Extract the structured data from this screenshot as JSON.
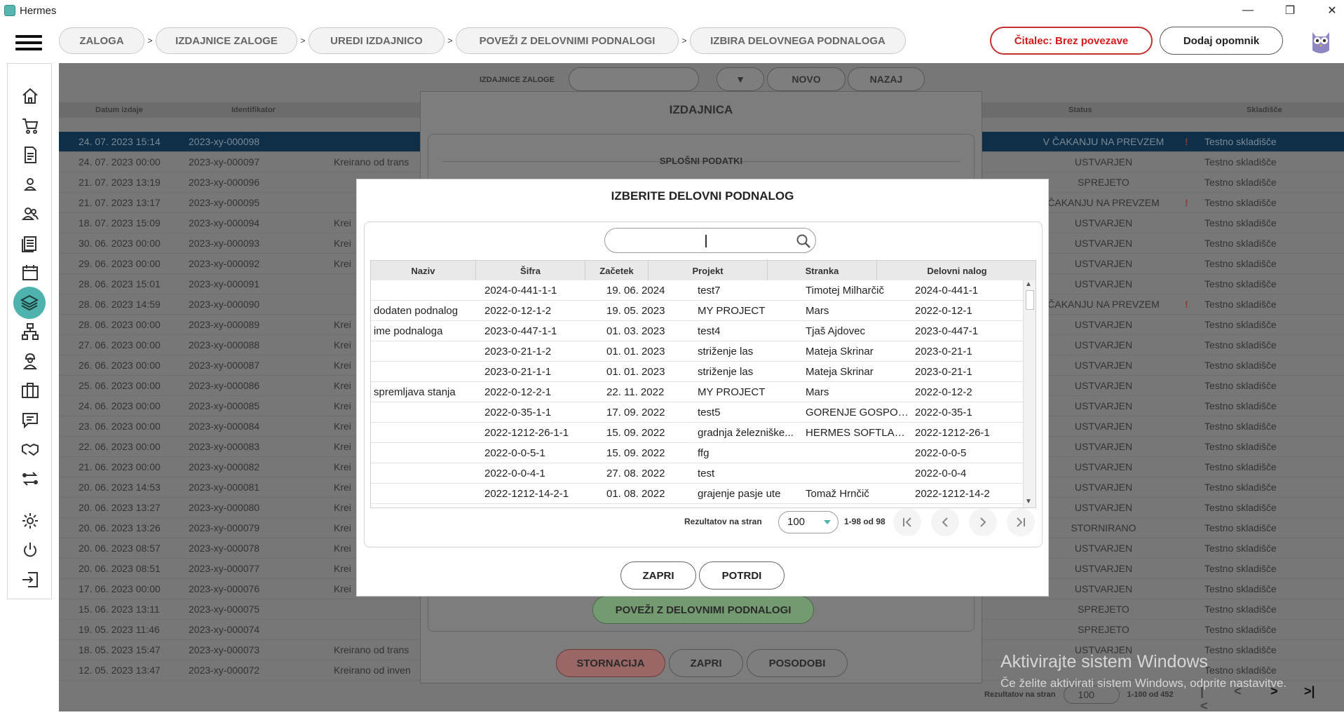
{
  "window": {
    "title": "Hermes"
  },
  "breadcrumbs": [
    "ZALOGA",
    "IZDAJNICE ZALOGE",
    "UREDI IZDAJNICO",
    "POVEŽI Z DELOVNIMI PODNALOGI",
    "IZBIRA DELOVNEGA PODNALOGA"
  ],
  "header": {
    "reader_status": "Čitalec: Brez povezave",
    "reminder_label": "Dodaj opomnik"
  },
  "background": {
    "toolbar_label": "IZDAJNICE ZALOGE",
    "new_label": "NOVO",
    "back_label": "NAZAJ",
    "columns": [
      "Datum izdaje",
      "Identifikator",
      "Status",
      "Skladišče"
    ],
    "rows": [
      [
        "24. 07. 2023 15:14",
        "2023-xy-000098",
        "",
        "V ČAKANJU NA PREVZEM",
        "Testno skladišče"
      ],
      [
        "24. 07. 2023 00:00",
        "2023-xy-000097",
        "Kreirano od trans",
        "USTVARJEN",
        "Testno skladišče"
      ],
      [
        "21. 07. 2023 13:19",
        "2023-xy-000096",
        "",
        "SPREJETO",
        "Testno skladišče"
      ],
      [
        "21. 07. 2023 13:17",
        "2023-xy-000095",
        "",
        "ČAKANJU NA PREVZEM",
        "Testno skladišče"
      ],
      [
        "18. 07. 2023 15:09",
        "2023-xy-000094",
        "Krei",
        "USTVARJEN",
        "Testno skladišče"
      ],
      [
        "30. 06. 2023 00:00",
        "2023-xy-000093",
        "Krei",
        "USTVARJEN",
        "Testno skladišče"
      ],
      [
        "29. 06. 2023 00:00",
        "2023-xy-000092",
        "Krei",
        "USTVARJEN",
        "Testno skladišče"
      ],
      [
        "28. 06. 2023 15:01",
        "2023-xy-000091",
        "",
        "USTVARJEN",
        "Testno skladišče"
      ],
      [
        "28. 06. 2023 14:59",
        "2023-xy-000090",
        "",
        "ČAKANJU NA PREVZEM",
        "Testno skladišče"
      ],
      [
        "28. 06. 2023 00:00",
        "2023-xy-000089",
        "Krei",
        "USTVARJEN",
        "Testno skladišče"
      ],
      [
        "27. 06. 2023 00:00",
        "2023-xy-000088",
        "Krei",
        "USTVARJEN",
        "Testno skladišče"
      ],
      [
        "26. 06. 2023 00:00",
        "2023-xy-000087",
        "Krei",
        "USTVARJEN",
        "Testno skladišče"
      ],
      [
        "25. 06. 2023 00:00",
        "2023-xy-000086",
        "Krei",
        "USTVARJEN",
        "Testno skladišče"
      ],
      [
        "24. 06. 2023 00:00",
        "2023-xy-000085",
        "Krei",
        "USTVARJEN",
        "Testno skladišče"
      ],
      [
        "23. 06. 2023 00:00",
        "2023-xy-000084",
        "Krei",
        "USTVARJEN",
        "Testno skladišče"
      ],
      [
        "22. 06. 2023 00:00",
        "2023-xy-000083",
        "Krei",
        "USTVARJEN",
        "Testno skladišče"
      ],
      [
        "21. 06. 2023 00:00",
        "2023-xy-000082",
        "Krei",
        "USTVARJEN",
        "Testno skladišče"
      ],
      [
        "20. 06. 2023 14:53",
        "2023-xy-000081",
        "Krei",
        "USTVARJEN",
        "Testno skladišče"
      ],
      [
        "20. 06. 2023 13:27",
        "2023-xy-000080",
        "Krei",
        "USTVARJEN",
        "Testno skladišče"
      ],
      [
        "20. 06. 2023 13:26",
        "2023-xy-000079",
        "Krei",
        "STORNIRANO",
        "Testno skladišče"
      ],
      [
        "20. 06. 2023 08:57",
        "2023-xy-000078",
        "Krei",
        "USTVARJEN",
        "Testno skladišče"
      ],
      [
        "20. 06. 2023 08:51",
        "2023-xy-000077",
        "Krei",
        "USTVARJEN",
        "Testno skladišče"
      ],
      [
        "17. 06. 2023 00:00",
        "2023-xy-000076",
        "Krei",
        "USTVARJEN",
        "Testno skladišče"
      ],
      [
        "15. 06. 2023 13:11",
        "2023-xy-000075",
        "",
        "SPREJETO",
        "Testno skladišče"
      ],
      [
        "19. 05. 2023 11:46",
        "2023-xy-000074",
        "",
        "SPREJETO",
        "Testno skladišče"
      ],
      [
        "18. 05. 2023 15:47",
        "2023-xy-000073",
        "Kreirano od trans",
        "USTVARJEN",
        "Testno skladišče"
      ],
      [
        "12. 05. 2023 13:47",
        "2023-xy-000072",
        "Kreirano od inven",
        "",
        "Testno skladišče"
      ]
    ],
    "pager": {
      "label": "Rezultatov na stran",
      "per_page": "100",
      "range": "1-100 od 452"
    }
  },
  "izdajnica": {
    "title": "IZDAJNICA",
    "section": "SPLOŠNI PODATKI",
    "link_button": "POVEŽI Z DELOVNIMI PODNALOGI",
    "cancel_button": "STORNACIJA",
    "close_button": "ZAPRI",
    "update_button": "POSODOBI"
  },
  "modal": {
    "title": "IZBERITE DELOVNI PODNALOG",
    "search_value": "",
    "columns": [
      "Naziv",
      "Šifra",
      "Začetek",
      "Projekt",
      "Stranka",
      "Delovni nalog"
    ],
    "rows": [
      [
        "",
        "2024-0-441-1-1",
        "19. 06. 2024",
        "test7",
        "Timotej Milharčič",
        "2024-0-441-1"
      ],
      [
        "dodaten podnalog",
        "2022-0-12-1-2",
        "19. 05. 2023",
        "MY PROJECT",
        "Mars",
        "2022-0-12-1"
      ],
      [
        "ime podnaloga",
        "2023-0-447-1-1",
        "01. 03. 2023",
        "test4",
        "Tjaš Ajdovec",
        "2023-0-447-1"
      ],
      [
        "",
        "2023-0-21-1-2",
        "01. 01. 2023",
        "striženje las",
        "Mateja Skrinar",
        "2023-0-21-1"
      ],
      [
        "",
        "2023-0-21-1-1",
        "01. 01. 2023",
        "striženje las",
        "Mateja Skrinar",
        "2023-0-21-1"
      ],
      [
        "spremljava stanja",
        "2022-0-12-2-1",
        "22. 11. 2022",
        "MY PROJECT",
        "Mars",
        "2022-0-12-2"
      ],
      [
        "",
        "2022-0-35-1-1",
        "17. 09. 2022",
        "test5",
        "GORENJE GOSPOD...",
        "2022-0-35-1"
      ],
      [
        "",
        "2022-1212-26-1-1",
        "15. 09. 2022",
        "gradnja železniške...",
        "HERMES SOFTLAB ...",
        "2022-1212-26-1"
      ],
      [
        "",
        "2022-0-0-5-1",
        "15. 09. 2022",
        "ffg",
        "",
        "2022-0-0-5"
      ],
      [
        "",
        "2022-0-0-4-1",
        "27. 08. 2022",
        "test",
        "",
        "2022-0-0-4"
      ],
      [
        "",
        "2022-1212-14-2-1",
        "01. 08. 2022",
        "grajenje pasje ute",
        "Tomaž Hrnčič",
        "2022-1212-14-2"
      ]
    ],
    "pager": {
      "label": "Rezultatov na stran",
      "per_page": "100",
      "range": "1-98 od 98"
    },
    "close_button": "ZAPRI",
    "confirm_button": "POTRDI"
  },
  "watermark": {
    "line1": "Aktivirajte sistem Windows",
    "line2": "Če želite aktivirati sistem Windows, odprite nastavitve."
  }
}
